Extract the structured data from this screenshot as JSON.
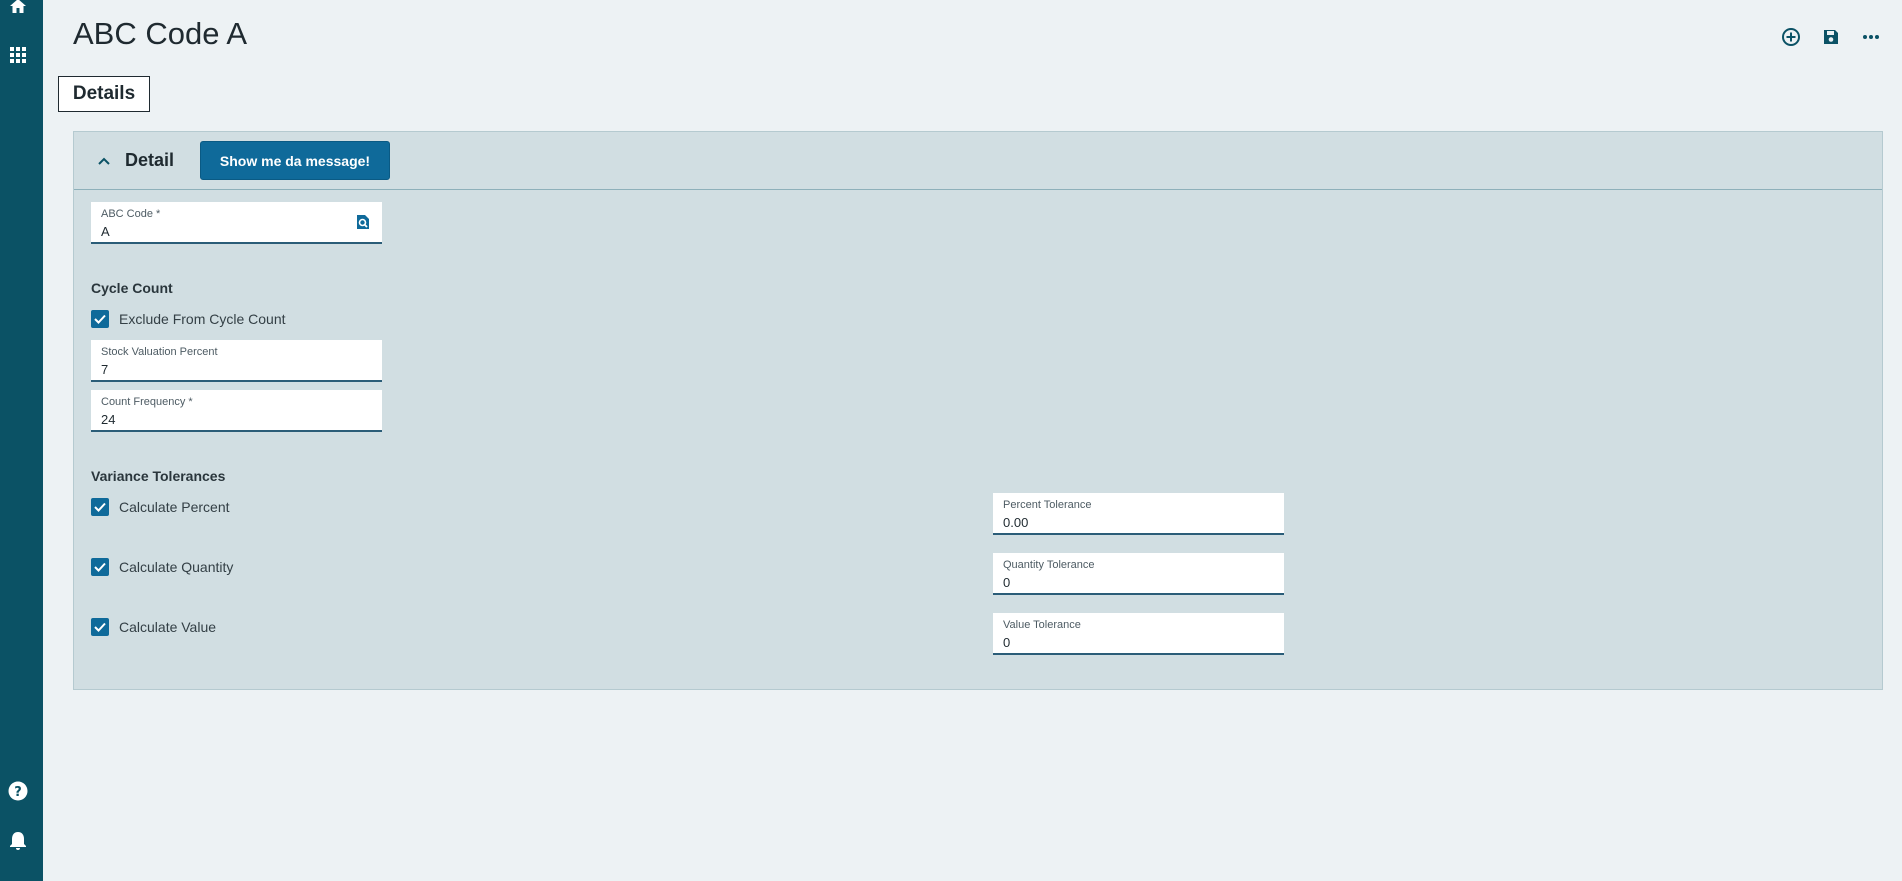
{
  "page": {
    "title": "ABC Code A"
  },
  "rail": {
    "top": [
      "home-icon",
      "apps-grid-icon"
    ],
    "bottom": [
      "help-icon",
      "notifications-icon"
    ]
  },
  "top_actions": [
    "add-circle-icon",
    "save-icon",
    "more-icon"
  ],
  "tabs": [
    {
      "label": "Details",
      "selected": true
    }
  ],
  "detail_panel": {
    "title": "Detail",
    "button_label": "Show me da message!",
    "abc_code": {
      "label": "ABC Code *",
      "value": "A"
    },
    "cycle_count": {
      "title": "Cycle Count",
      "exclude": {
        "label": "Exclude From Cycle Count",
        "checked": true
      },
      "stock_valuation_percent": {
        "label": "Stock Valuation Percent",
        "value": "7"
      },
      "count_frequency": {
        "label": "Count Frequency *",
        "value": "24"
      }
    },
    "variance": {
      "title": "Variance Tolerances",
      "calc_percent": {
        "label": "Calculate Percent",
        "checked": true
      },
      "calc_quantity": {
        "label": "Calculate Quantity",
        "checked": true
      },
      "calc_value": {
        "label": "Calculate Value",
        "checked": true
      },
      "percent_tolerance": {
        "label": "Percent Tolerance",
        "value": "0.00"
      },
      "quantity_tolerance": {
        "label": "Quantity Tolerance",
        "value": "0"
      },
      "value_tolerance": {
        "label": "Value Tolerance",
        "value": "0"
      }
    }
  },
  "colors": {
    "rail": "#0b5265",
    "accent": "#0f6a9a",
    "panel": "#d1dee2",
    "page": "#edf2f4"
  }
}
